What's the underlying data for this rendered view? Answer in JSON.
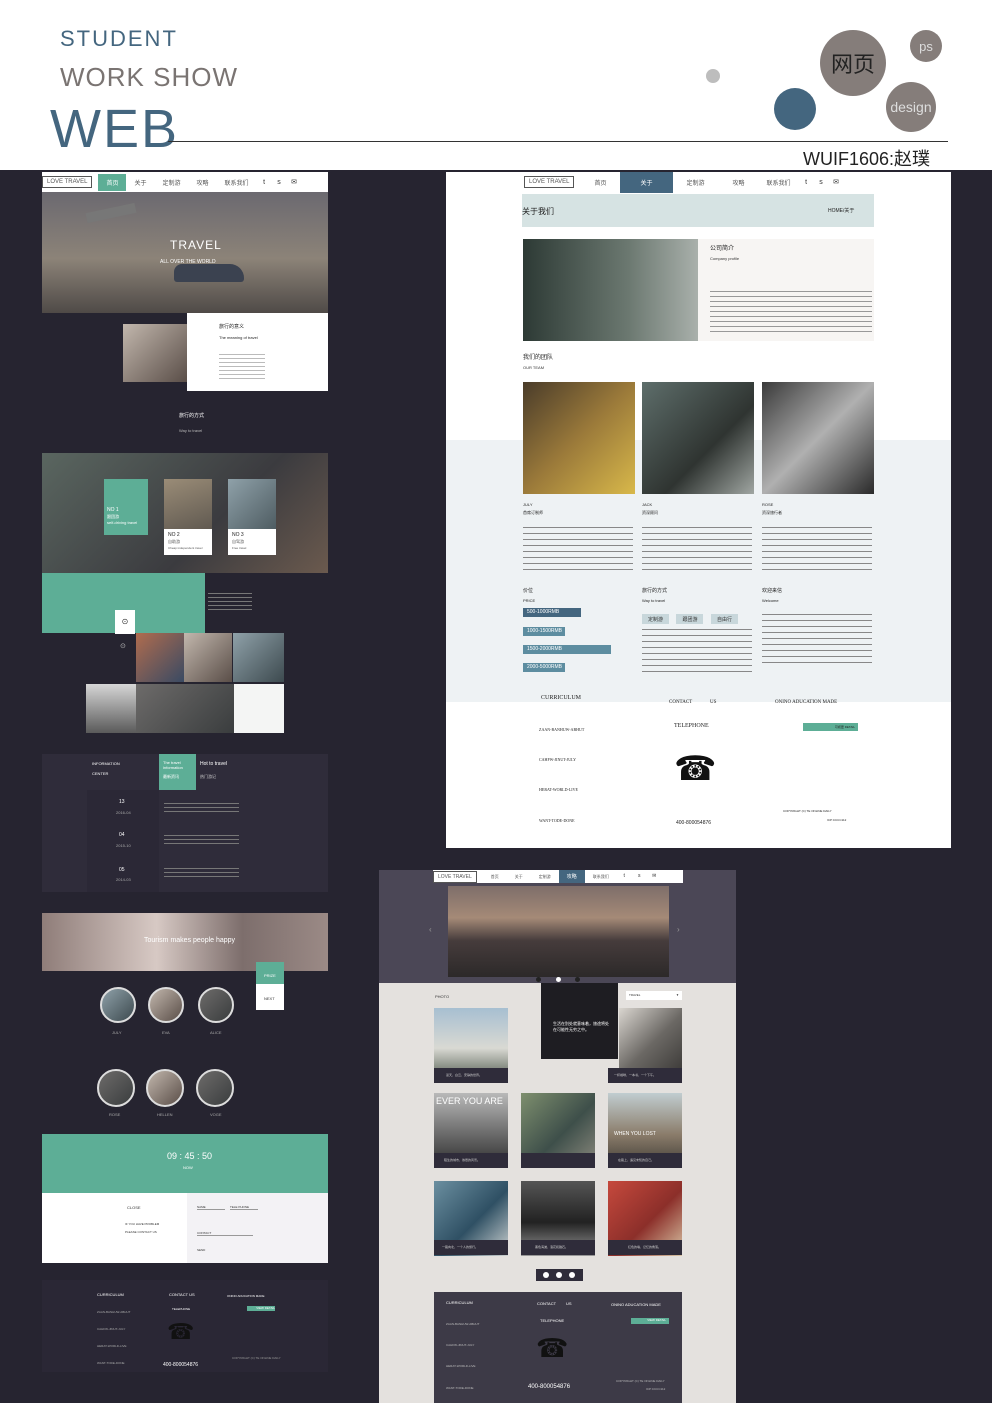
{
  "header": {
    "student": "STUDENT",
    "work_show": "WORK SHOW",
    "web": "WEB",
    "code": "WUIF1606:赵璞",
    "bubble_wangye": "网页",
    "bubble_ps": "ps",
    "bubble_design": "design"
  },
  "colors": {
    "teal": "#5dae96",
    "slate_blue": "#44667f",
    "dark_bg": "#262430",
    "gray": "#857d7a"
  },
  "icons": [
    "twitter-icon",
    "skype-icon",
    "mail-icon",
    "phone-icon",
    "play-icon"
  ],
  "home": {
    "nav": {
      "logo": "LOVE TRAVEL",
      "items": [
        "首页",
        "关于",
        "定制游",
        "攻略",
        "联系我们"
      ],
      "active": "首页"
    },
    "hero_title": "TRAVEL",
    "hero_sub": "ALL OVER THE WORLD",
    "meaning_title": "旅行的意义",
    "meaning_sub": "The meaning of travel",
    "way_title": "旅行的方式",
    "way_sub": "Way to travel",
    "cards": [
      {
        "no": "NO 1",
        "name": "跟团游",
        "en": "self-driving travel"
      },
      {
        "no": "NO 2",
        "name": "自助游",
        "en": "Cheap independent travel"
      },
      {
        "no": "NO 3",
        "name": "自驾游",
        "en": "Free travel"
      }
    ],
    "info_center": "INFORMATION CENTER",
    "tab_active": "The travel information",
    "tab_active_cn": "最新资讯",
    "tab_other": "Hot to travel",
    "tab_other_cn": "热门游记",
    "news": [
      {
        "day": "13",
        "date": "2016-04"
      },
      {
        "day": "04",
        "date": "2015-10"
      },
      {
        "day": "05",
        "date": "2014-03"
      }
    ],
    "banner_text": "Tourism makes people happy",
    "prize": "PRIZE",
    "next": "NEXT",
    "people_row1": [
      "JULY",
      "EVA",
      "ALICE"
    ],
    "people_row2": [
      "ROSE",
      "HELLEN",
      "VOGE"
    ],
    "clock": "09 : 45 : 50",
    "clock_now": "NOW",
    "form": {
      "close": "CLOSE",
      "if_you": "IF YOU HAVE PROBLEM",
      "please": "PLEASE CONTACT US",
      "name": "NAME",
      "tel": "TELE PHONE",
      "contact": "CONTACT",
      "send": "SEND"
    }
  },
  "footer": {
    "curriculum": "CURRICULUM",
    "links": [
      "ZAAN-BANHUW-ABHUT",
      "CAHFW-JINUT-JULY",
      "HERAT-WORLD-LIVE",
      "WANT-TODE-DONE"
    ],
    "contact_us": "CONTACT US",
    "contact": "CONTACT",
    "us": "US",
    "telephone": "TELEPHONE",
    "number": "400-800054876",
    "onino": "ONINO ADUCATION MADE",
    "view_detail": "VIEW DETAIL",
    "view_detail_cn": "可视更 DETAIL",
    "copyright": "COPYRIGHT (C) TE ONLINE DAILY",
    "icp": "ICP:CCCC112"
  },
  "about": {
    "nav": {
      "logo": "LOVE TRAVEL",
      "items": [
        "首页",
        "关于",
        "定制游",
        "攻略",
        "联系我们"
      ],
      "active": "关于"
    },
    "title": "关于我们",
    "crumb": "HOME/关于",
    "company": "公司简介",
    "company_en": "Company profile",
    "team": "我们的团队",
    "team_en": "OUR TEAM",
    "members": [
      {
        "name": "JULY",
        "role": "首席订制师"
      },
      {
        "name": "JACK",
        "role": "资深顾问"
      },
      {
        "name": "ROSE",
        "role": "资深旅行者"
      }
    ],
    "price": "价位",
    "price_en": "PRICE",
    "prices": [
      "500-1000RMB",
      "1000-1500RMB",
      "1500-2000RMB",
      "2000-5000RMB"
    ],
    "way": "旅行的方式",
    "way_en": "Way to travel",
    "way_btns": [
      "定制游",
      "跟团游",
      "自由行"
    ],
    "welcome": "欢迎来信",
    "welcome_en": "Welcome"
  },
  "guide": {
    "nav": {
      "logo": "LOVE TRAVEL",
      "items": [
        "首页",
        "关于",
        "定制游",
        "攻略",
        "联系我们"
      ],
      "active": "攻略"
    },
    "photo": "PHOTO",
    "select": "TRAVEL",
    "quote": "生活在别处就意味着，旅途将处在可能性无穷之中。",
    "captions": [
      "蓝天，白云，安静的世界。",
      "一杯咖啡，一本书，一个下午。",
      "EVER YOU ARE",
      "陌生的城市，熟悉的风景。",
      "WHEN YOU LOST",
      "在路上，遇见未知的自己。",
      "一路向北，一个人的旅行。",
      "黑色海滩，浪花和礁石。",
      "红色的墙，记忆的角落。"
    ],
    "hero_img_text": "EVER YOU ARE"
  }
}
